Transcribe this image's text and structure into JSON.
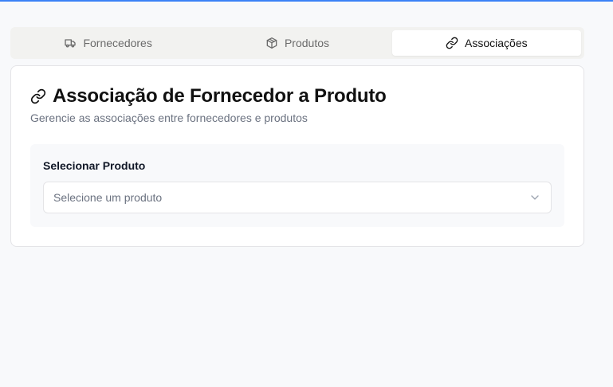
{
  "tabs": [
    {
      "label": "Fornecedores",
      "icon": "truck-icon",
      "active": false
    },
    {
      "label": "Produtos",
      "icon": "package-icon",
      "active": false
    },
    {
      "label": "Associações",
      "icon": "link-icon",
      "active": true
    }
  ],
  "card": {
    "title": "Associação de Fornecedor a Produto",
    "subtitle": "Gerencie as associações entre fornecedores e produtos",
    "icon": "link-icon"
  },
  "product_select": {
    "label": "Selecionar Produto",
    "placeholder": "Selecione um produto",
    "icon": "chevron-down-icon"
  },
  "colors": {
    "accent": "#3b82f6",
    "background": "#f8f9fb",
    "text_muted": "#6b7280"
  }
}
